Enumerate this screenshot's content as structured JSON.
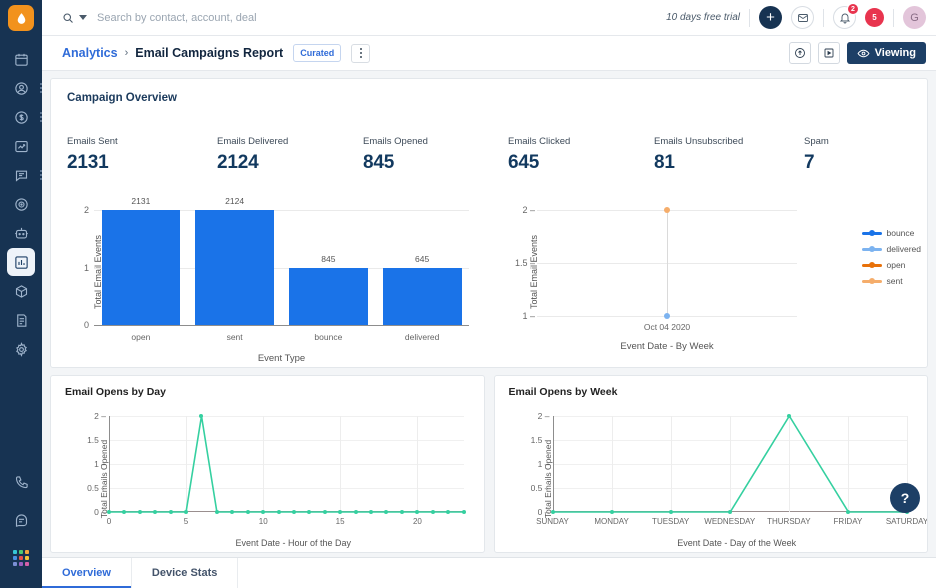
{
  "brand": {
    "accent_blue": "#2f6bd8",
    "dark_navy": "#173352",
    "logo_orange": "#f2921d",
    "bar_blue": "#1a73e8",
    "line_green": "#35d0a0",
    "badge_red": "#e8344e"
  },
  "rail": {
    "logo_icon": "drop-logo-icon",
    "items": [
      {
        "icon": "calendar-icon",
        "name": "calendar",
        "dots": false
      },
      {
        "icon": "contacts-icon",
        "name": "contacts",
        "dots": true
      },
      {
        "icon": "deals-dollar-icon",
        "name": "deals",
        "dots": true
      },
      {
        "icon": "trending-line-icon",
        "name": "forecast",
        "dots": false
      },
      {
        "icon": "chat-message-icon",
        "name": "conversations",
        "dots": true
      },
      {
        "icon": "target-icon",
        "name": "goals",
        "dots": false
      },
      {
        "icon": "bot-icon",
        "name": "bots",
        "dots": false
      },
      {
        "icon": "bar-chart-icon",
        "name": "analytics",
        "dots": false,
        "active": true
      },
      {
        "icon": "box-package-icon",
        "name": "products",
        "dots": false
      },
      {
        "icon": "document-icon",
        "name": "documents",
        "dots": false
      },
      {
        "icon": "gear-icon",
        "name": "settings",
        "dots": false
      }
    ],
    "bottom_items": [
      {
        "icon": "phone-icon",
        "name": "phone"
      },
      {
        "icon": "support-chat-icon",
        "name": "support"
      },
      {
        "icon": "apps-grid-icon",
        "name": "apps"
      }
    ]
  },
  "topbar": {
    "search_icon": "search-icon",
    "search_placeholder": "Search by contact, account, deal",
    "search_value": "",
    "trial_text": "10 days free trial",
    "add_label": "+",
    "mail_icon": "envelope-icon",
    "notifications_icon": "notification-bell-icon",
    "notifications_badge": "2",
    "alerts_badge": "5",
    "avatar_initial": "G"
  },
  "breadcrumb": {
    "parent": "Analytics",
    "separator": "›",
    "title": "Email Campaigns Report",
    "chip": "Curated",
    "kebab_name": "more-options"
  },
  "toolbar": {
    "share_icon": "share-upload-icon",
    "present_icon": "present-play-icon",
    "viewing_label": "Viewing",
    "viewing_icon": "eye-icon"
  },
  "overview": {
    "title": "Campaign Overview",
    "kpis": [
      {
        "label": "Emails Sent",
        "value": "2131"
      },
      {
        "label": "Emails Delivered",
        "value": "2124"
      },
      {
        "label": "Emails Opened",
        "value": "845"
      },
      {
        "label": "Emails Clicked",
        "value": "645"
      },
      {
        "label": "Emails Unsubscribed",
        "value": "81"
      },
      {
        "label": "Spam",
        "value": "7"
      }
    ]
  },
  "panels": {
    "opens_by_day_title": "Email Opens by Day",
    "opens_by_week_title": "Email Opens by Week"
  },
  "tabs": [
    {
      "label": "Overview",
      "active": true
    },
    {
      "label": "Device Stats",
      "active": false
    }
  ],
  "help_fab": "?",
  "chart_data": [
    {
      "type": "bar",
      "id": "event-type-bar",
      "title": "",
      "xlabel": "Event Type",
      "ylabel": "Total Email Events",
      "categories": [
        "open",
        "sent",
        "bounce",
        "delivered"
      ],
      "values": [
        2,
        2,
        1,
        1
      ],
      "data_labels": [
        "2131",
        "2124",
        "845",
        "645"
      ],
      "ylim": [
        0,
        2
      ],
      "yticks": [
        0,
        1,
        2
      ],
      "grid": true,
      "legend": "none",
      "color": "#1a73e8"
    },
    {
      "type": "line",
      "id": "events-by-week",
      "title": "",
      "xlabel": "Event Date - By Week",
      "ylabel": "Total Email Events",
      "x": [
        "Oct 04 2020"
      ],
      "series": [
        {
          "name": "bounce",
          "color": "#1a73e8",
          "values": [
            1
          ]
        },
        {
          "name": "delivered",
          "color": "#7cb3f0",
          "values": [
            1
          ]
        },
        {
          "name": "open",
          "color": "#e8710a",
          "values": [
            2
          ]
        },
        {
          "name": "sent",
          "color": "#f5ad6b",
          "values": [
            2
          ]
        }
      ],
      "ylim": [
        1,
        2
      ],
      "yticks": [
        1,
        1.5,
        2
      ],
      "grid": true,
      "legend": "right"
    },
    {
      "type": "line",
      "id": "opens-by-day",
      "title": "Email Opens by Day",
      "xlabel": "Event Date - Hour of the Day",
      "ylabel": "Total Emails Opened",
      "x": [
        0,
        1,
        2,
        3,
        4,
        5,
        6,
        7,
        8,
        9,
        10,
        11,
        12,
        13,
        14,
        15,
        16,
        17,
        18,
        19,
        20,
        21,
        22,
        23
      ],
      "values": [
        0,
        0,
        0,
        0,
        0,
        0,
        2,
        0,
        0,
        0,
        0,
        0,
        0,
        0,
        0,
        0,
        0,
        0,
        0,
        0,
        0,
        0,
        0,
        0
      ],
      "xticks": [
        0,
        5,
        10,
        15,
        20
      ],
      "yticks": [
        0,
        0.5,
        1,
        1.5,
        2
      ],
      "ylim": [
        0,
        2
      ],
      "grid": true,
      "legend": "none",
      "color": "#35d0a0"
    },
    {
      "type": "line",
      "id": "opens-by-week",
      "title": "Email Opens by Week",
      "xlabel": "Event Date - Day of the Week",
      "ylabel": "Total Emails Opened",
      "x": [
        "SUNDAY",
        "MONDAY",
        "TUESDAY",
        "WEDNESDAY",
        "THURSDAY",
        "FRIDAY",
        "SATURDAY"
      ],
      "values": [
        0,
        0,
        0,
        0,
        2,
        0,
        0
      ],
      "yticks": [
        0,
        0.5,
        1,
        1.5,
        2
      ],
      "ylim": [
        0,
        2
      ],
      "grid": true,
      "legend": "none",
      "color": "#35d0a0"
    }
  ]
}
